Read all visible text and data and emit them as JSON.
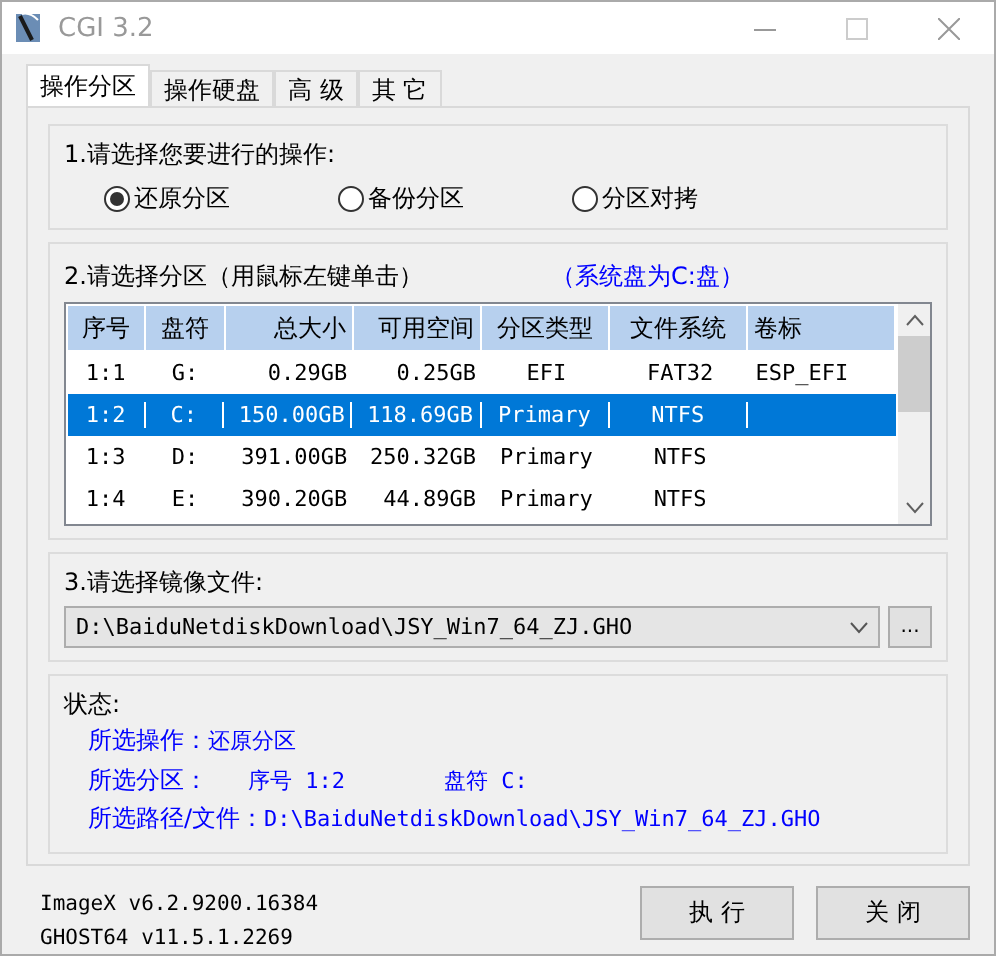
{
  "window": {
    "title": "CGI 3.2"
  },
  "tabs": [
    {
      "label": "操作分区",
      "selected": true
    },
    {
      "label": "操作硬盘",
      "selected": false
    },
    {
      "label": "高 级",
      "selected": false
    },
    {
      "label": "其 它",
      "selected": false
    }
  ],
  "operation": {
    "title": "1.请选择您要进行的操作:",
    "options": [
      {
        "label": "还原分区",
        "selected": true
      },
      {
        "label": "备份分区",
        "selected": false
      },
      {
        "label": "分区对拷",
        "selected": false
      }
    ]
  },
  "partition": {
    "title": "2.请选择分区（用鼠标左键单击）",
    "note": "（系统盘为C:盘）",
    "table": {
      "columns": [
        "序号",
        "盘符",
        "总大小",
        "可用空间",
        "分区类型",
        "文件系统",
        "卷标"
      ],
      "rows": [
        {
          "cells": [
            "1:1",
            "G:",
            "0.29GB",
            "0.25GB",
            "EFI",
            "FAT32",
            "ESP_EFI"
          ],
          "selected": false
        },
        {
          "cells": [
            "1:2",
            "C:",
            "150.00GB",
            "118.69GB",
            "Primary",
            "NTFS",
            ""
          ],
          "selected": true
        },
        {
          "cells": [
            "1:3",
            "D:",
            "391.00GB",
            "250.32GB",
            "Primary",
            "NTFS",
            ""
          ],
          "selected": false
        },
        {
          "cells": [
            "1:4",
            "E:",
            "390.20GB",
            "44.89GB",
            "Primary",
            "NTFS",
            ""
          ],
          "selected": false
        }
      ]
    }
  },
  "image": {
    "title": "3.请选择镜像文件:",
    "value": "D:\\BaiduNetdiskDownload\\JSY_Win7_64_ZJ.GHO",
    "browse": "..."
  },
  "status": {
    "title": "状态:",
    "lines": [
      [
        "所选操作：",
        "还原分区"
      ],
      [
        "所选分区：",
        "序号 1:2",
        "盘符 C:"
      ],
      [
        "所选路径/文件：",
        "D:\\BaiduNetdiskDownload\\JSY_Win7_64_ZJ.GHO"
      ]
    ]
  },
  "versions": [
    "ImageX v6.2.9200.16384",
    "GHOST64 v11.5.1.2269"
  ],
  "buttons": [
    "执 行",
    "关 闭"
  ]
}
